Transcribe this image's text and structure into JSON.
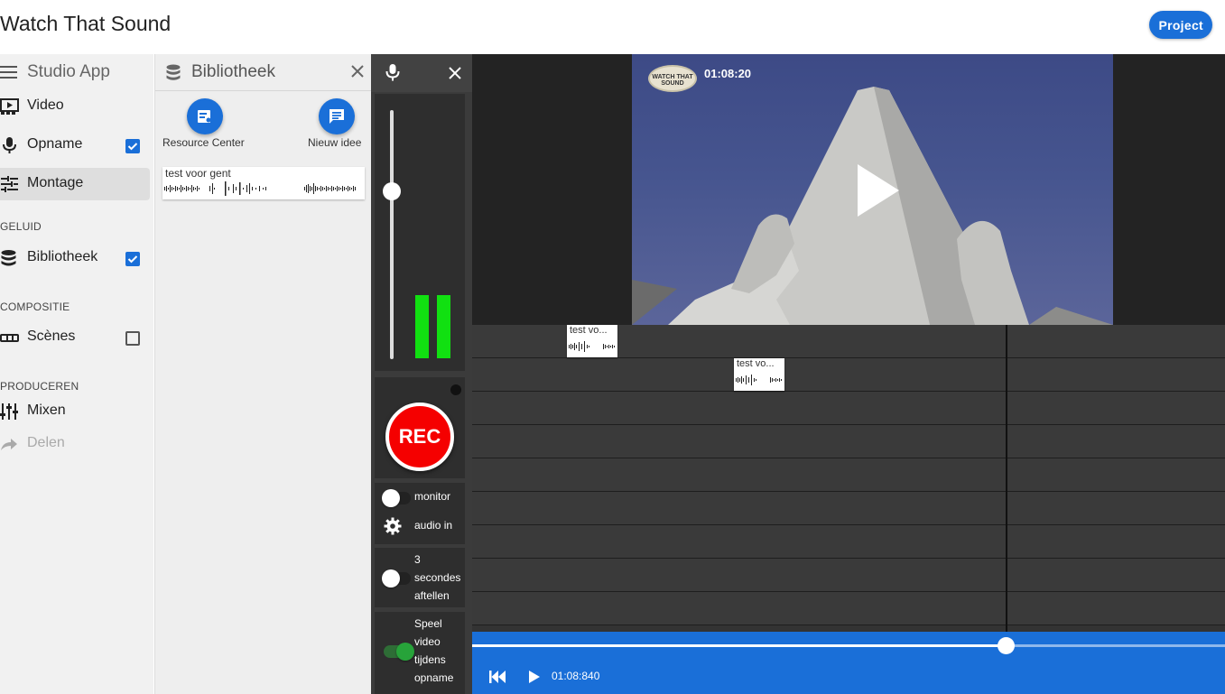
{
  "header": {
    "title": "Watch That Sound",
    "project_label": "Project"
  },
  "sidebar": {
    "app_label": "Studio App",
    "items": [
      {
        "label": "Video",
        "icon": "video-icon"
      },
      {
        "label": "Opname",
        "icon": "mic-icon",
        "checked": true
      },
      {
        "label": "Montage",
        "icon": "tune-icon",
        "active": true
      }
    ],
    "sections": [
      {
        "title": "GELUID",
        "items": [
          {
            "label": "Bibliotheek",
            "icon": "database-icon",
            "checked": true
          }
        ]
      },
      {
        "title": "COMPOSITIE",
        "items": [
          {
            "label": "Scènes",
            "icon": "scenes-icon",
            "checked": false
          }
        ]
      },
      {
        "title": "PRODUCEREN",
        "items": [
          {
            "label": "Mixen",
            "icon": "mixer-icon"
          },
          {
            "label": "Delen",
            "icon": "share-icon",
            "disabled": true
          }
        ]
      }
    ]
  },
  "library": {
    "title": "Bibliotheek",
    "resource_label": "Resource Center",
    "new_idea_label": "Nieuw idee",
    "clip": {
      "name": "test voor gent"
    }
  },
  "recorder": {
    "rec_label": "REC",
    "monitor_label": "monitor",
    "audio_in_label": "audio in",
    "countdown_label": "3 secondes aftellen",
    "play_video_label": "Speel video tijdens opname",
    "monitor_on": false,
    "countdown_on": false,
    "play_video_on": true
  },
  "editor": {
    "video_timecode": "01:08:20",
    "logo_text": "WATCH THAT SOUND",
    "clips": [
      {
        "name": "test vo..."
      },
      {
        "name": "test vo..."
      }
    ],
    "transport_timecode": "01:08:840"
  },
  "colors": {
    "accent": "#1a6fd8",
    "rec": "#f50000",
    "meter": "#11e011"
  }
}
